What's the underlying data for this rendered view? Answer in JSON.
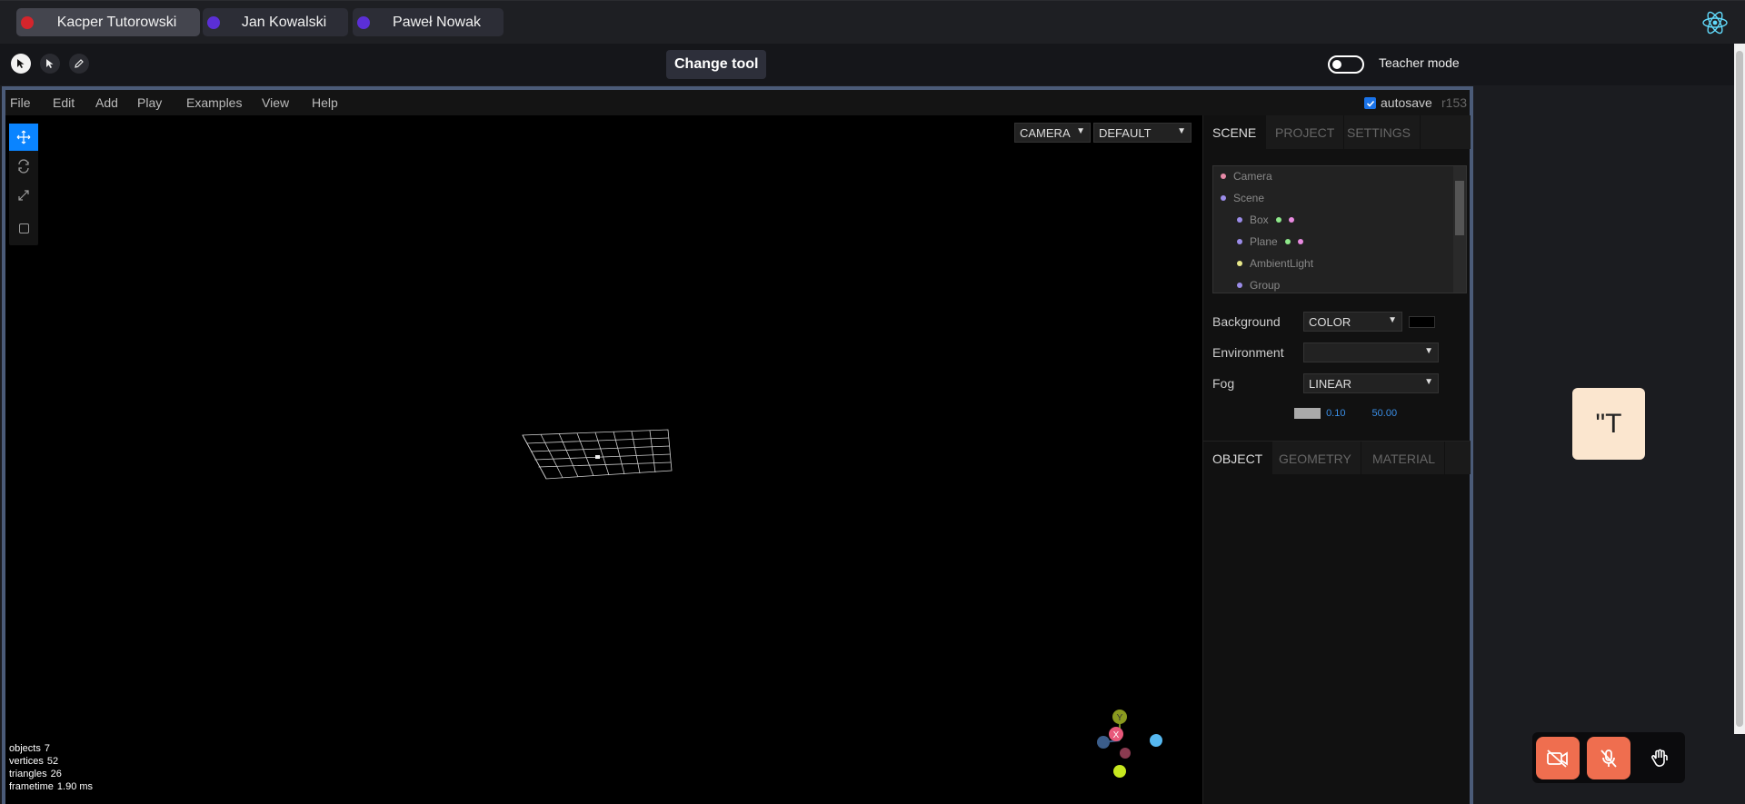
{
  "users": [
    {
      "name": "Kacper Tutorowski",
      "color": "#d4252c",
      "active": true
    },
    {
      "name": "Jan Kowalski",
      "color": "#5b2fd6",
      "active": false
    },
    {
      "name": "Paweł Nowak",
      "color": "#5b2fd6",
      "active": false
    }
  ],
  "toolbar": {
    "change_tool_label": "Change tool",
    "teacher_mode_label": "Teacher mode",
    "teacher_mode_on": false
  },
  "editor": {
    "menu": [
      "File",
      "Edit",
      "Add",
      "Play",
      "Examples",
      "View",
      "Help"
    ],
    "autosave_label": "autosave",
    "autosave_checked": true,
    "revision": "r153",
    "camera_select": "CAMERA",
    "shading_select": "DEFAULT",
    "info": {
      "objects_label": "objects",
      "objects": "7",
      "vertices_label": "vertices",
      "vertices": "52",
      "triangles_label": "triangles",
      "triangles": "26",
      "frametime_label": "frametime",
      "frametime": "1.90 ms"
    },
    "gizmo": {
      "y_label": "Y",
      "x_label": "X"
    },
    "sidebar": {
      "tabs": [
        "SCENE",
        "PROJECT",
        "SETTINGS"
      ],
      "outliner": [
        {
          "name": "Camera",
          "dot": "#e88aa8",
          "indent": 0,
          "extras": []
        },
        {
          "name": "Scene",
          "dot": "#9b8ce8",
          "indent": 0,
          "extras": []
        },
        {
          "name": "Box",
          "dot": "#9b8ce8",
          "indent": 1,
          "extras": [
            "#8ee88a",
            "#e88ae0"
          ]
        },
        {
          "name": "Plane",
          "dot": "#9b8ce8",
          "indent": 1,
          "extras": [
            "#8ee88a",
            "#e88ae0"
          ]
        },
        {
          "name": "AmbientLight",
          "dot": "#e8e88a",
          "indent": 1,
          "extras": []
        },
        {
          "name": "Group",
          "dot": "#9b8ce8",
          "indent": 1,
          "extras": []
        }
      ],
      "background_label": "Background",
      "background_value": "COLOR",
      "environment_label": "Environment",
      "environment_value": "",
      "fog_label": "Fog",
      "fog_value": "LINEAR",
      "fog_near": "0.10",
      "fog_far": "50.00",
      "object_tabs": [
        "OBJECT",
        "GEOMETRY",
        "MATERIAL"
      ]
    }
  },
  "participant_card": {
    "initials": "\"T"
  },
  "icons": {
    "camera_off": "camera-off-icon",
    "mic_off": "mic-off-icon",
    "hand": "raise-hand-icon",
    "react": "react-logo-icon"
  },
  "colors": {
    "accent": "#0a84ff",
    "danger": "#ef6e4f",
    "frame": "#4b5b78"
  }
}
